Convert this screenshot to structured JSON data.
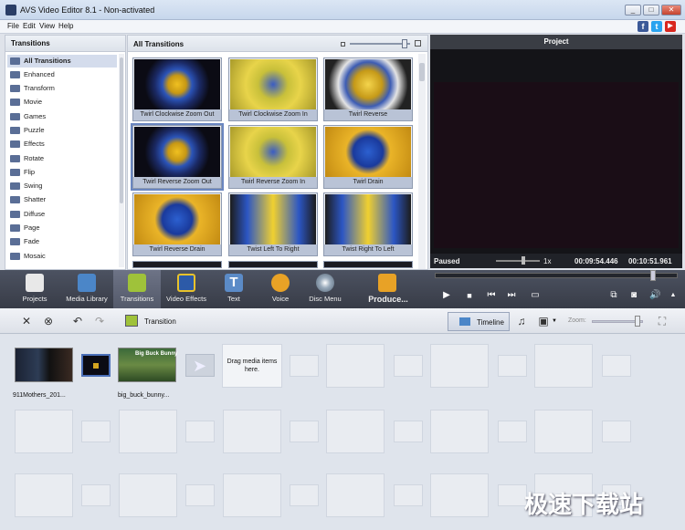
{
  "window": {
    "title": "AVS Video Editor 8.1 - Non-activated",
    "minimize": "_",
    "maximize": "□",
    "close": "✕"
  },
  "menu": [
    "File",
    "Edit",
    "View",
    "Help"
  ],
  "social": {
    "facebook": "f",
    "twitter": "t",
    "youtube": "▶"
  },
  "left_panel": {
    "header": "Transitions",
    "categories": [
      "All Transitions",
      "Enhanced",
      "Transform",
      "Movie",
      "Games",
      "Puzzle",
      "Effects",
      "Rotate",
      "Flip",
      "Swing",
      "Shatter",
      "Diffuse",
      "Page",
      "Fade",
      "Mosaic"
    ]
  },
  "mid_panel": {
    "header": "All Transitions",
    "tiles": [
      {
        "label": "Twirl Clockwise Zoom Out",
        "style": "dark"
      },
      {
        "label": "Twirl Clockwise Zoom In",
        "style": "yellow"
      },
      {
        "label": "Twirl Reverse",
        "style": "rev"
      },
      {
        "label": "Twirl Reverse Zoom Out",
        "style": "dark"
      },
      {
        "label": "Twirl Reverse Zoom In",
        "style": "yellow"
      },
      {
        "label": "Twirl Drain",
        "style": "drain"
      },
      {
        "label": "Twirl Reverse Drain",
        "style": "drain"
      },
      {
        "label": "Twist Left To Right",
        "style": "twist"
      },
      {
        "label": "Twist Right To Left",
        "style": "twist"
      }
    ]
  },
  "project": {
    "header": "Project",
    "status": "Paused",
    "speed": "1x",
    "current_time": "00:09:54.446",
    "total_time": "00:10:51.961"
  },
  "toolbar": [
    "Projects",
    "Media Library",
    "Transitions",
    "Video Effects",
    "Text",
    "Voice",
    "Disc Menu",
    "Produce..."
  ],
  "edit_bar": {
    "transition_label": "Transition",
    "timeline_label": "Timeline",
    "zoom_label": "Zoom:"
  },
  "storyboard": {
    "clip1_name": "911Mothers_201...",
    "clip2_name": "big_buck_bunny...",
    "clip2_overlay": "Big Buck Bunny",
    "drop_hint": "Drag media items here."
  },
  "watermark": "极速下载站",
  "colors": {
    "toolbar_bg": "#454a57",
    "selected_tab": "#656b7d",
    "accent": "#6a86c0"
  }
}
